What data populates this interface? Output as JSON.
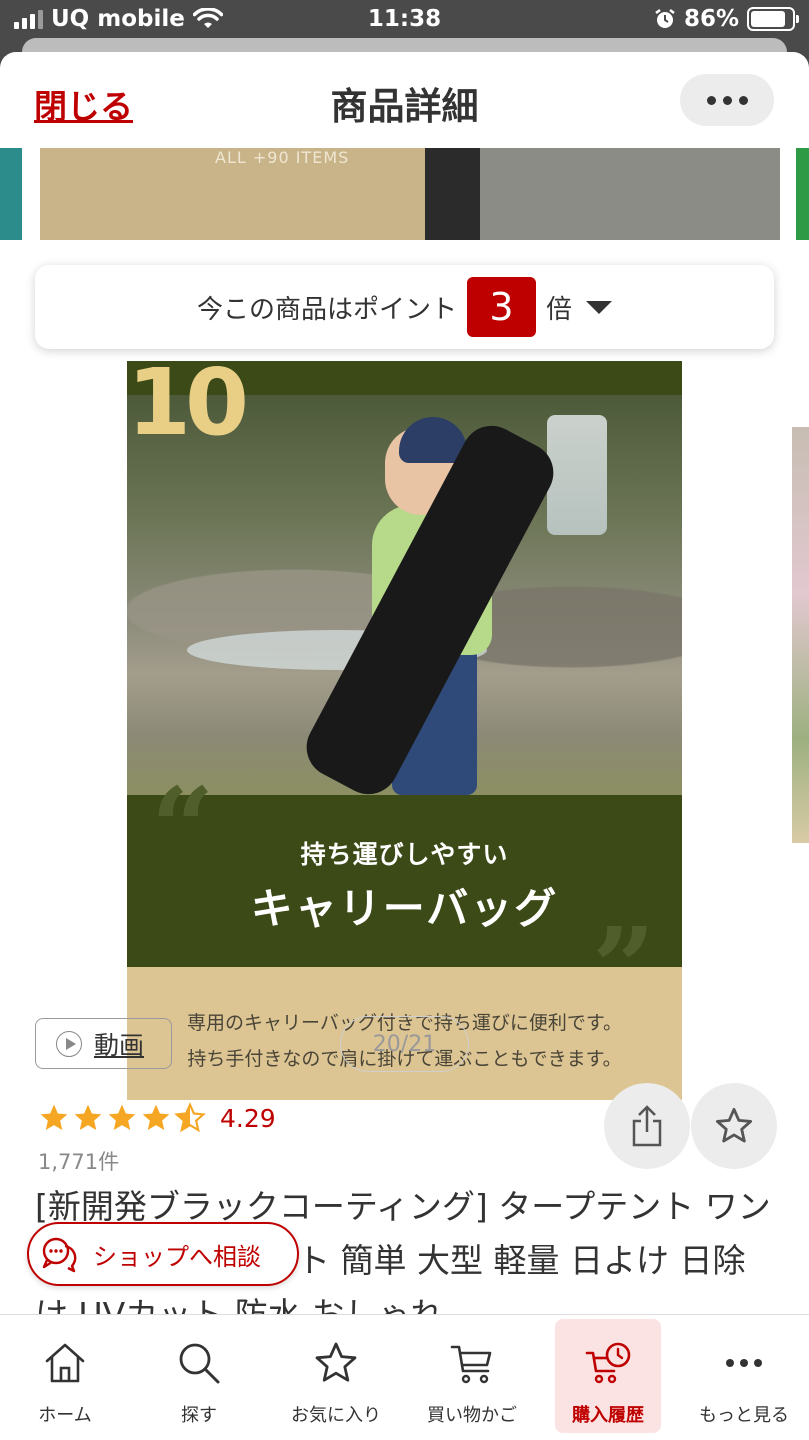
{
  "status_bar": {
    "carrier": "UQ mobile",
    "time": "11:38",
    "battery": "86%"
  },
  "header": {
    "close_label": "閉じる",
    "title": "商品詳細"
  },
  "points_banner": {
    "prefix": "今この商品はポイント",
    "multiplier": "3",
    "suffix": "倍"
  },
  "carousel_image": {
    "number": "10",
    "subtitle": "持ち運びしやすい",
    "title": "キャリーバッグ",
    "description_line1": "専用のキャリーバッグ付きで持ち運びに便利です。",
    "description_line2": "持ち手付きなので肩に掛けて運ぶこともできます。",
    "peek_text": "ALL +90 ITEMS"
  },
  "media": {
    "video_label": "動画",
    "page_counter": "20/21"
  },
  "rating": {
    "stars": 4.29,
    "value": "4.29",
    "review_count": "1,771件"
  },
  "product": {
    "title": "[新開発ブラックコーティング] タープテント ワンタッチタープテント 簡単 大型 軽量 日よけ 日除け UVカット 防水 おしゃれ"
  },
  "shop_consult": {
    "label": "ショップへ相談"
  },
  "tab_bar": {
    "items": [
      {
        "label": "ホーム",
        "icon": "home-icon"
      },
      {
        "label": "探す",
        "icon": "search-icon"
      },
      {
        "label": "お気に入り",
        "icon": "star-icon"
      },
      {
        "label": "買い物かご",
        "icon": "cart-icon"
      },
      {
        "label": "購入履歴",
        "icon": "purchase-history-icon",
        "active": true
      },
      {
        "label": "もっと見る",
        "icon": "more-dots-icon"
      }
    ]
  },
  "colors": {
    "brand_red": "#bf0000",
    "star_orange": "#f5a623"
  }
}
